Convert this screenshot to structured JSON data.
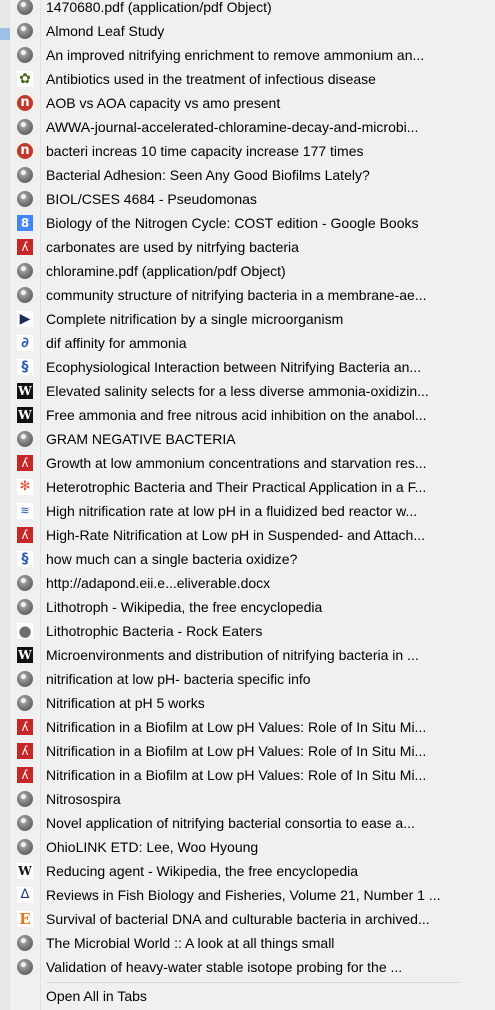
{
  "menu": {
    "items": [
      {
        "label": "1470680.pdf (application/pdf Object)",
        "icon": "globe-icon"
      },
      {
        "label": "Almond Leaf Study",
        "icon": "globe-icon"
      },
      {
        "label": "An improved nitrifying enrichment to remove ammonium an...",
        "icon": "globe-icon"
      },
      {
        "label": "Antibiotics used in the treatment of infectious disease",
        "icon": "bio-icon"
      },
      {
        "label": "AOB vs AOA capacity vs amo present",
        "icon": "ncbi-icon"
      },
      {
        "label": "AWWA-journal-accelerated-chloramine-decay-and-microbi...",
        "icon": "globe-icon"
      },
      {
        "label": "bacteri increas 10 time capacity increase 177 times",
        "icon": "ncbi-icon"
      },
      {
        "label": "Bacterial Adhesion: Seen Any Good Biofilms Lately?",
        "icon": "globe-icon"
      },
      {
        "label": "BIOL/CSES 4684 - Pseudomonas",
        "icon": "globe-icon"
      },
      {
        "label": "Biology of the Nitrogen Cycle: COST edition - Google Books",
        "icon": "google-icon"
      },
      {
        "label": "carbonates are used by nitrfying bacteria",
        "icon": "pdf-icon"
      },
      {
        "label": "chloramine.pdf (application/pdf Object)",
        "icon": "globe-icon"
      },
      {
        "label": "community structure of nitrifying bacteria in a membrane-ae...",
        "icon": "globe-icon"
      },
      {
        "label": "Complete nitrification by a single microorganism",
        "icon": "arrow-icon"
      },
      {
        "label": "dif affinity for ammonia",
        "icon": "curl-icon"
      },
      {
        "label": "Ecophysiological Interaction between Nitrifying Bacteria an...",
        "icon": "dna-icon"
      },
      {
        "label": "Elevated salinity selects for a less diverse ammonia-oxidizin...",
        "icon": "wiley-icon"
      },
      {
        "label": "Free ammonia and free nitrous acid inhibition on the anabol...",
        "icon": "wiley-icon"
      },
      {
        "label": "GRAM NEGATIVE BACTERIA",
        "icon": "globe-icon"
      },
      {
        "label": "Growth at low ammonium concentrations and starvation res...",
        "icon": "pdf-icon"
      },
      {
        "label": "Heterotrophic Bacteria and Their Practical Application in a F...",
        "icon": "joomla-icon"
      },
      {
        "label": "High nitrification rate at low pH in a fluidized bed reactor w...",
        "icon": "wave-icon"
      },
      {
        "label": "High-Rate Nitrification at Low pH in Suspended- and Attach...",
        "icon": "pdf-icon"
      },
      {
        "label": "how much can a single bacteria oxidize?",
        "icon": "dna-icon"
      },
      {
        "label": "http://adapond.eii.e...eliverable.docx",
        "icon": "globe-icon"
      },
      {
        "label": "Lithotroph - Wikipedia, the free encyclopedia",
        "icon": "globe-icon"
      },
      {
        "label": "Lithotrophic Bacteria - Rock Eaters",
        "icon": "apple-icon"
      },
      {
        "label": "Microenvironments and distribution of nitrifying bacteria in ...",
        "icon": "wiley-icon"
      },
      {
        "label": "nitrification at low pH- bacteria specific info",
        "icon": "globe-icon"
      },
      {
        "label": "Nitrification at pH 5 works",
        "icon": "globe-icon"
      },
      {
        "label": "Nitrification in a Biofilm at Low pH Values: Role of In Situ Mi...",
        "icon": "pdf-icon"
      },
      {
        "label": "Nitrification in a Biofilm at Low pH Values: Role of In Situ Mi...",
        "icon": "pdf-outline-icon"
      },
      {
        "label": "Nitrification in a Biofilm at Low pH Values: Role of In Situ Mi...",
        "icon": "pdf-outline-icon"
      },
      {
        "label": "Nitrosospira",
        "icon": "globe-icon"
      },
      {
        "label": "Novel application of nitrifying bacterial consortia to ease a...",
        "icon": "globe-icon"
      },
      {
        "label": "OhioLINK ETD: Lee, Woo Hyoung",
        "icon": "globe-icon"
      },
      {
        "label": "Reducing agent - Wikipedia, the free encyclopedia",
        "icon": "wikipedia-icon"
      },
      {
        "label": "Reviews in Fish Biology and Fisheries, Volume 21, Number 1 ...",
        "icon": "springer-icon"
      },
      {
        "label": "Survival of bacterial DNA and culturable bacteria in archived...",
        "icon": "elsevier-icon"
      },
      {
        "label": "The Microbial World :: A look at all things small",
        "icon": "globe-icon"
      },
      {
        "label": "Validation of heavy-water stable isotope probing for the ...",
        "icon": "globe-icon"
      }
    ],
    "open_all_label": "Open All in Tabs"
  },
  "icon_glyphs": {
    "google-icon": "8",
    "ncbi-icon": "n",
    "wiley-icon": "W",
    "wikipedia-icon": "W",
    "arrow-icon": "▶",
    "curl-icon": "∂",
    "dna-icon": "§",
    "joomla-icon": "✻",
    "wave-icon": "≋",
    "apple-icon": "●",
    "springer-icon": "∆",
    "elsevier-icon": "E",
    "bio-icon": "✿",
    "pdf-icon": "ʎ",
    "pdf-outline-icon": "ʎ"
  }
}
